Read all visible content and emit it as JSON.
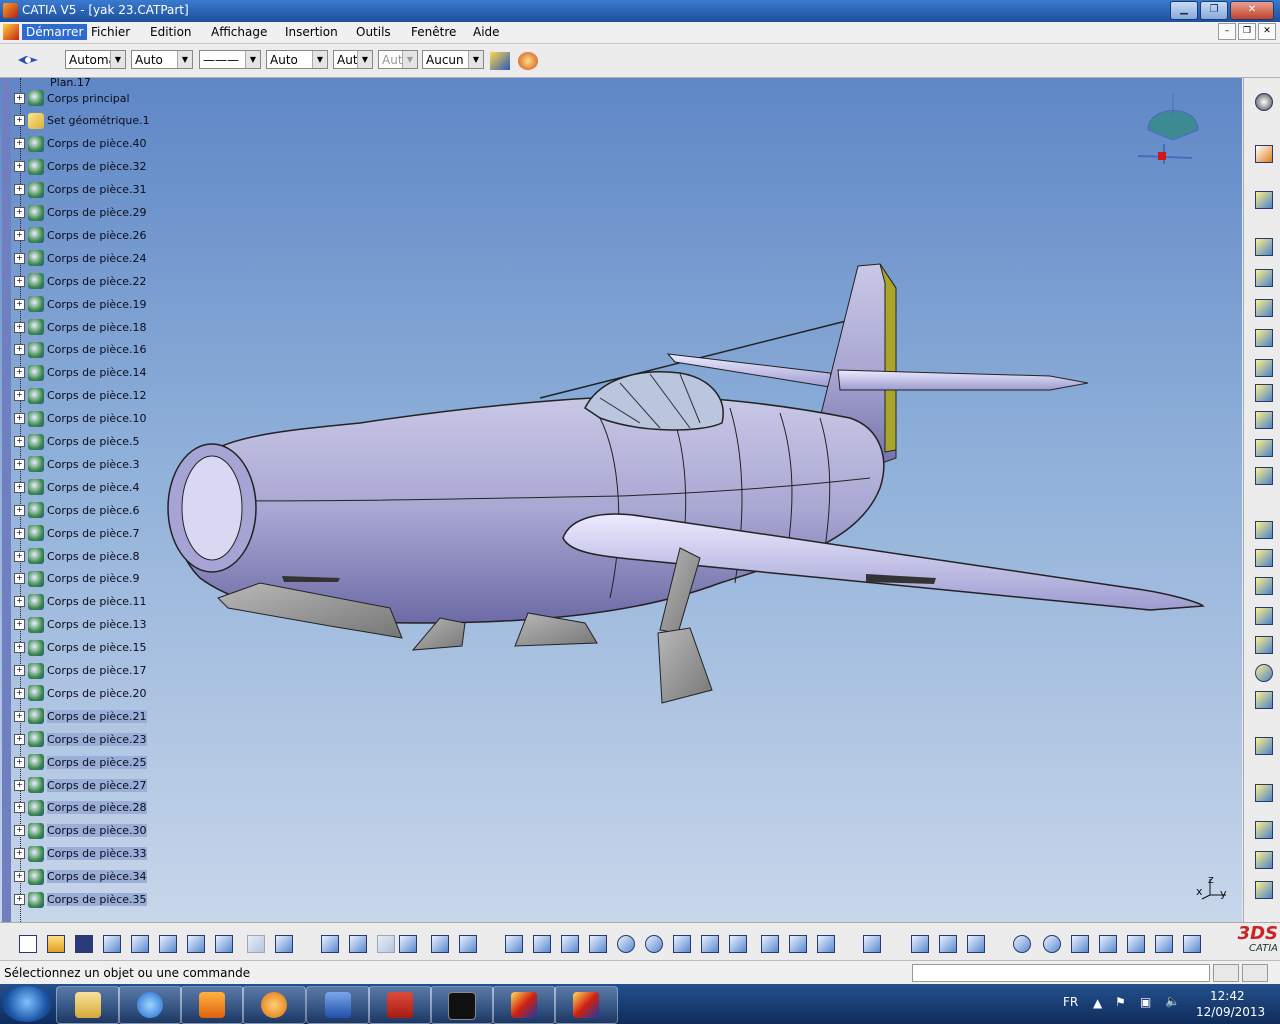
{
  "window": {
    "title": "CATIA V5 - [yak 23.CATPart]"
  },
  "menubar": {
    "items": [
      "Démarrer",
      "Fichier",
      "Edition",
      "Affichage",
      "Insertion",
      "Outils",
      "Fenêtre",
      "Aide"
    ]
  },
  "properties": {
    "fill": "Automa",
    "transparency": "Auto",
    "linetype": "———",
    "thickness": "Auto",
    "layer1": "Aut",
    "layer2": "Aut",
    "layer_select": "Aucun"
  },
  "tree": {
    "partial_top": "Plan.17",
    "items": [
      {
        "label": "Corps principal",
        "hl": false
      },
      {
        "label": "Set géométrique.1",
        "hl": false
      },
      {
        "label": "Corps de pièce.40",
        "hl": false
      },
      {
        "label": "Corps de pièce.32",
        "hl": false
      },
      {
        "label": "Corps de pièce.31",
        "hl": false
      },
      {
        "label": "Corps de pièce.29",
        "hl": false
      },
      {
        "label": "Corps de pièce.26",
        "hl": false
      },
      {
        "label": "Corps de pièce.24",
        "hl": false
      },
      {
        "label": "Corps de pièce.22",
        "hl": false
      },
      {
        "label": "Corps de pièce.19",
        "hl": false
      },
      {
        "label": "Corps de pièce.18",
        "hl": false
      },
      {
        "label": "Corps de pièce.16",
        "hl": false
      },
      {
        "label": "Corps de pièce.14",
        "hl": false
      },
      {
        "label": "Corps de pièce.12",
        "hl": false
      },
      {
        "label": "Corps de pièce.10",
        "hl": false
      },
      {
        "label": "Corps de pièce.5",
        "hl": false
      },
      {
        "label": "Corps de pièce.3",
        "hl": false
      },
      {
        "label": "Corps de pièce.4",
        "hl": false
      },
      {
        "label": "Corps de pièce.6",
        "hl": false
      },
      {
        "label": "Corps de pièce.7",
        "hl": false
      },
      {
        "label": "Corps de pièce.8",
        "hl": false
      },
      {
        "label": "Corps de pièce.9",
        "hl": false
      },
      {
        "label": "Corps de pièce.11",
        "hl": false
      },
      {
        "label": "Corps de pièce.13",
        "hl": false
      },
      {
        "label": "Corps de pièce.15",
        "hl": false
      },
      {
        "label": "Corps de pièce.17",
        "hl": false
      },
      {
        "label": "Corps de pièce.20",
        "hl": false
      },
      {
        "label": "Corps de pièce.21",
        "hl": true
      },
      {
        "label": "Corps de pièce.23",
        "hl": true
      },
      {
        "label": "Corps de pièce.25",
        "hl": true
      },
      {
        "label": "Corps de pièce.27",
        "hl": true
      },
      {
        "label": "Corps de pièce.28",
        "hl": true
      },
      {
        "label": "Corps de pièce.30",
        "hl": true
      },
      {
        "label": "Corps de pièce.33",
        "hl": true
      },
      {
        "label": "Corps de pièce.34",
        "hl": true
      },
      {
        "label": "Corps de pièce.35",
        "hl": true
      }
    ]
  },
  "axes": {
    "x": "x",
    "y": "y",
    "z": "z"
  },
  "logo": {
    "brand": "3DS",
    "product": "CATIA"
  },
  "status": {
    "message": "Sélectionnez un objet ou une commande"
  },
  "taskbar": {
    "lang": "FR",
    "time": "12:42",
    "date": "12/09/2013"
  }
}
